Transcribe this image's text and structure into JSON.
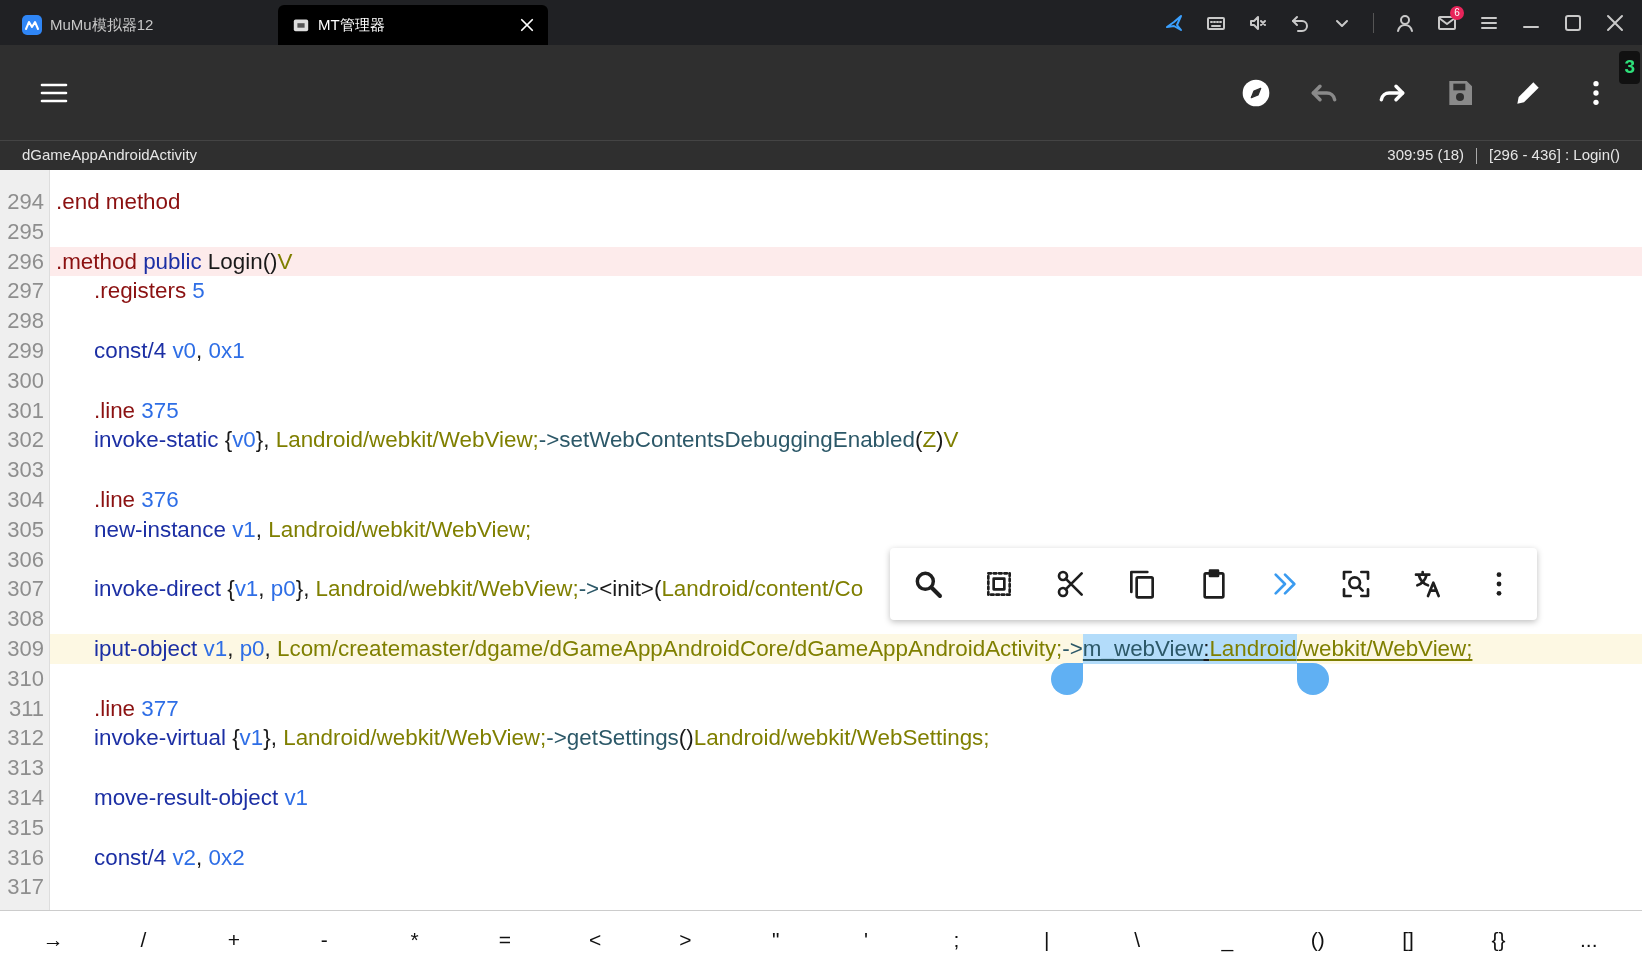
{
  "titlebar": {
    "tabs": [
      {
        "label": "MuMu模拟器12",
        "selected": false
      },
      {
        "label": "MT管理器",
        "selected": true
      }
    ],
    "mail_badge": "6"
  },
  "toolbar": {
    "actions": [
      {
        "kind": "navigate",
        "disabled": false
      },
      {
        "kind": "undo",
        "disabled": true
      },
      {
        "kind": "redo",
        "disabled": false
      },
      {
        "kind": "save",
        "disabled": true
      },
      {
        "kind": "edit",
        "disabled": false
      },
      {
        "kind": "more",
        "disabled": false
      }
    ],
    "badge": "3"
  },
  "status": {
    "class_name": "dGameAppAndroidActivity",
    "cursor": "309:95 (18)",
    "range": "[296 - 436] : Login()"
  },
  "lines": [
    {
      "number": "294",
      "kind": "plain",
      "tokens": [
        {
          "text": ".end method",
          "kind": "directive"
        }
      ]
    },
    {
      "number": "295",
      "kind": "plain"
    },
    {
      "number": "296",
      "kind": "method_header",
      "tokens": [
        {
          "text": ".method",
          "kind": "directive"
        },
        {
          "text": " public",
          "kind": "op"
        },
        {
          "text": " Login()",
          "kind": "punct"
        },
        {
          "text": "V",
          "kind": "type"
        }
      ]
    },
    {
      "number": "297",
      "kind": "plain",
      "tokens": [
        {
          "text": "\t.registers",
          "kind": "directive"
        },
        {
          "text": " 5",
          "kind": "number"
        }
      ]
    },
    {
      "number": "298",
      "kind": "plain"
    },
    {
      "number": "299",
      "kind": "plain",
      "tokens": [
        {
          "text": "\tconst/4",
          "kind": "op"
        },
        {
          "text": " v0",
          "kind": "reg"
        },
        {
          "text": ", ",
          "kind": "punct"
        },
        {
          "text": "0x1",
          "kind": "number"
        }
      ]
    },
    {
      "number": "300",
      "kind": "plain"
    },
    {
      "number": "301",
      "kind": "plain",
      "tokens": [
        {
          "text": "\t.line",
          "kind": "directive"
        },
        {
          "text": " 375",
          "kind": "number"
        }
      ]
    },
    {
      "number": "302",
      "kind": "plain",
      "tokens": [
        {
          "text": "\tinvoke-static",
          "kind": "op"
        },
        {
          "text": " {",
          "kind": "punct"
        },
        {
          "text": "v0",
          "kind": "reg"
        },
        {
          "text": "}, ",
          "kind": "punct"
        },
        {
          "text": "Landroid/webkit/WebView;",
          "kind": "type"
        },
        {
          "text": "->setWebContentsDebuggingEnabled",
          "kind": "method"
        },
        {
          "text": "(",
          "kind": "punct"
        },
        {
          "text": "Z",
          "kind": "type"
        },
        {
          "text": ")",
          "kind": "punct"
        },
        {
          "text": "V",
          "kind": "type"
        }
      ]
    },
    {
      "number": "303",
      "kind": "plain"
    },
    {
      "number": "304",
      "kind": "plain",
      "tokens": [
        {
          "text": "\t.line",
          "kind": "directive"
        },
        {
          "text": " 376",
          "kind": "number"
        }
      ]
    },
    {
      "number": "305",
      "kind": "plain",
      "tokens": [
        {
          "text": "\tnew-instance",
          "kind": "op"
        },
        {
          "text": " v1",
          "kind": "reg"
        },
        {
          "text": ", ",
          "kind": "punct"
        },
        {
          "text": "Landroid/webkit/WebView;",
          "kind": "type"
        }
      ]
    },
    {
      "number": "306",
      "kind": "plain"
    },
    {
      "number": "307",
      "kind": "plain",
      "tokens": [
        {
          "text": "\tinvoke-direct",
          "kind": "op"
        },
        {
          "text": " {",
          "kind": "punct"
        },
        {
          "text": "v1",
          "kind": "reg"
        },
        {
          "text": ", ",
          "kind": "punct"
        },
        {
          "text": "p0",
          "kind": "reg"
        },
        {
          "text": "}, ",
          "kind": "punct"
        },
        {
          "text": "Landroid/webkit/WebView;",
          "kind": "type"
        },
        {
          "text": "->",
          "kind": "method"
        },
        {
          "text": "<init>",
          "kind": "punct"
        },
        {
          "text": "(",
          "kind": "punct"
        },
        {
          "text": "Landroid/content/Co",
          "kind": "type"
        }
      ]
    },
    {
      "number": "308",
      "kind": "plain"
    },
    {
      "number": "309",
      "kind": "current",
      "tokens": [
        {
          "text": "\tiput-object",
          "kind": "op",
          "selected": false,
          "underlined": false
        },
        {
          "text": " v1",
          "kind": "reg",
          "selected": false,
          "underlined": false
        },
        {
          "text": ", ",
          "kind": "punct",
          "selected": false,
          "underlined": false
        },
        {
          "text": "p0",
          "kind": "reg",
          "selected": false,
          "underlined": false
        },
        {
          "text": ", ",
          "kind": "punct",
          "selected": false,
          "underlined": false
        },
        {
          "text": "Lcom/createmaster/dgame/dGameAppAndroidCore/dGameAppAndroidActivity;",
          "kind": "type",
          "selected": false,
          "underlined": false
        },
        {
          "text": "->",
          "kind": "method",
          "selected": false,
          "underlined": false
        },
        {
          "text": "m_webView",
          "kind": "method",
          "selected": true,
          "underlined": true
        },
        {
          "text": ":",
          "kind": "punct",
          "selected": true,
          "underlined": true
        },
        {
          "text": "Landroid",
          "kind": "type",
          "selected": true,
          "underlined": true
        },
        {
          "text": "/webkit/WebView;",
          "kind": "type",
          "selected": false,
          "underlined": true
        }
      ]
    },
    {
      "number": "310",
      "kind": "plain"
    },
    {
      "number": "311",
      "kind": "plain",
      "tokens": [
        {
          "text": "\t.line",
          "kind": "directive"
        },
        {
          "text": " 377",
          "kind": "number"
        }
      ]
    },
    {
      "number": "312",
      "kind": "plain",
      "tokens": [
        {
          "text": "\tinvoke-virtual",
          "kind": "op"
        },
        {
          "text": " {",
          "kind": "punct"
        },
        {
          "text": "v1",
          "kind": "reg"
        },
        {
          "text": "}, ",
          "kind": "punct"
        },
        {
          "text": "Landroid/webkit/WebView;",
          "kind": "type"
        },
        {
          "text": "->getSettings",
          "kind": "method"
        },
        {
          "text": "()",
          "kind": "punct"
        },
        {
          "text": "Landroid/webkit/WebSettings;",
          "kind": "type"
        }
      ]
    },
    {
      "number": "313",
      "kind": "plain"
    },
    {
      "number": "314",
      "kind": "plain",
      "tokens": [
        {
          "text": "\tmove-result-object",
          "kind": "op"
        },
        {
          "text": " v1",
          "kind": "reg"
        }
      ]
    },
    {
      "number": "315",
      "kind": "plain"
    },
    {
      "number": "316",
      "kind": "plain",
      "tokens": [
        {
          "text": "\tconst/4",
          "kind": "op"
        },
        {
          "text": " v2",
          "kind": "reg"
        },
        {
          "text": ", ",
          "kind": "punct"
        },
        {
          "text": "0x2",
          "kind": "number"
        }
      ]
    },
    {
      "number": "317",
      "kind": "plain"
    }
  ],
  "keys": [
    "→",
    "/",
    "+",
    "-",
    "*",
    "=",
    "<",
    ">",
    "\"",
    "'",
    ";",
    "|",
    "\\",
    "_",
    "()",
    "[]",
    "{}",
    "..."
  ]
}
